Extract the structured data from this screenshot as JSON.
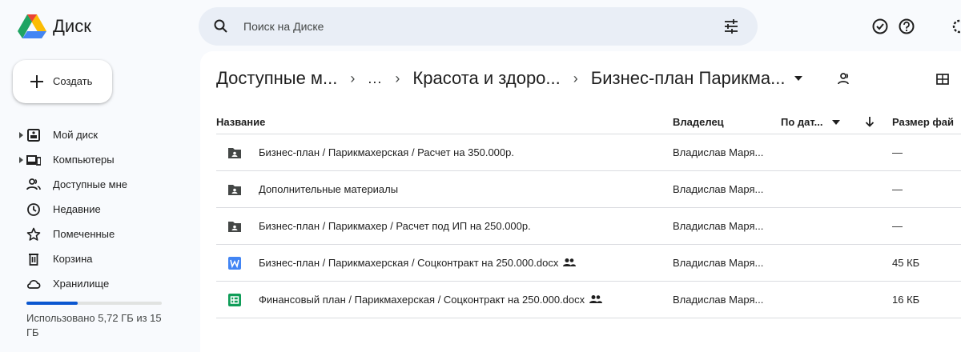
{
  "app": {
    "name": "Диск"
  },
  "search": {
    "placeholder": "Поиск на Диске"
  },
  "sidebar": {
    "create_label": "Создать",
    "items": [
      {
        "label": "Мой диск",
        "icon": "my-drive-icon",
        "expandable": true
      },
      {
        "label": "Компьютеры",
        "icon": "computer-icon",
        "expandable": true
      },
      {
        "label": "Доступные мне",
        "icon": "shared-with-me-icon",
        "expandable": false
      },
      {
        "label": "Недавние",
        "icon": "clock-icon",
        "expandable": false
      },
      {
        "label": "Помеченные",
        "icon": "star-icon",
        "expandable": false
      },
      {
        "label": "Корзина",
        "icon": "trash-icon",
        "expandable": false
      },
      {
        "label": "Хранилище",
        "icon": "cloud-icon",
        "expandable": false
      }
    ],
    "storage": {
      "used_fraction": 0.38,
      "text": "Использовано 5,72 ГБ из 15 ГБ"
    }
  },
  "breadcrumb": {
    "items": [
      "Доступные м...",
      "...",
      "Красота и здоро...",
      "Бизнес-план Парикма..."
    ]
  },
  "table": {
    "columns": {
      "name": "Название",
      "owner": "Владелец",
      "date": "По дат...",
      "size": "Размер фай"
    },
    "rows": [
      {
        "type": "folder",
        "name": "Бизнес-план / Парикмахерская / Расчет на 350.000р.",
        "shared": false,
        "owner": "Владислав Маря...",
        "size": "—"
      },
      {
        "type": "folder",
        "name": "Дополнительные материалы",
        "shared": false,
        "owner": "Владислав Маря...",
        "size": "—"
      },
      {
        "type": "folder",
        "name": "Бизнес-план / Парикмахер / Расчет под ИП на 250.000р.",
        "shared": false,
        "owner": "Владислав Маря...",
        "size": "—"
      },
      {
        "type": "word",
        "name": "Бизнес-план / Парикмахерская / Соцконтракт на 250.000.docx",
        "shared": true,
        "owner": "Владислав Маря...",
        "size": "45 КБ"
      },
      {
        "type": "sheets",
        "name": "Финансовый план / Парикмахерская / Соцконтракт на 250.000.docx",
        "shared": true,
        "owner": "Владислав Маря...",
        "size": "16 КБ"
      }
    ]
  },
  "colors": {
    "accent": "#0b57d0",
    "search_bg": "#e9eef6",
    "word": "#4285f4",
    "sheets": "#0f9d58",
    "folder": "#444746"
  }
}
